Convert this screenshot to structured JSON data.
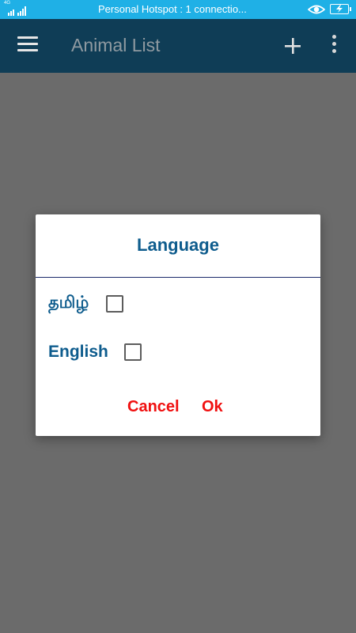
{
  "status_bar": {
    "network_label": "4G",
    "notification_text": "Personal Hotspot : 1 connectio...",
    "icons": [
      "signal-icon",
      "eye-icon",
      "battery-charging-icon"
    ],
    "color": "#1fb0e6"
  },
  "app_bar": {
    "title": "Animal List",
    "icons": [
      "menu-icon",
      "add-icon",
      "more-vert-icon"
    ],
    "color": "#0f3d56"
  },
  "dialog": {
    "title": "Language",
    "options": [
      {
        "label": "தமிழ்",
        "checked": false
      },
      {
        "label": "English",
        "checked": false
      }
    ],
    "buttons": {
      "cancel": "Cancel",
      "ok": "Ok"
    },
    "accent_color": "#0e5c8d",
    "button_color": "#f01010"
  }
}
